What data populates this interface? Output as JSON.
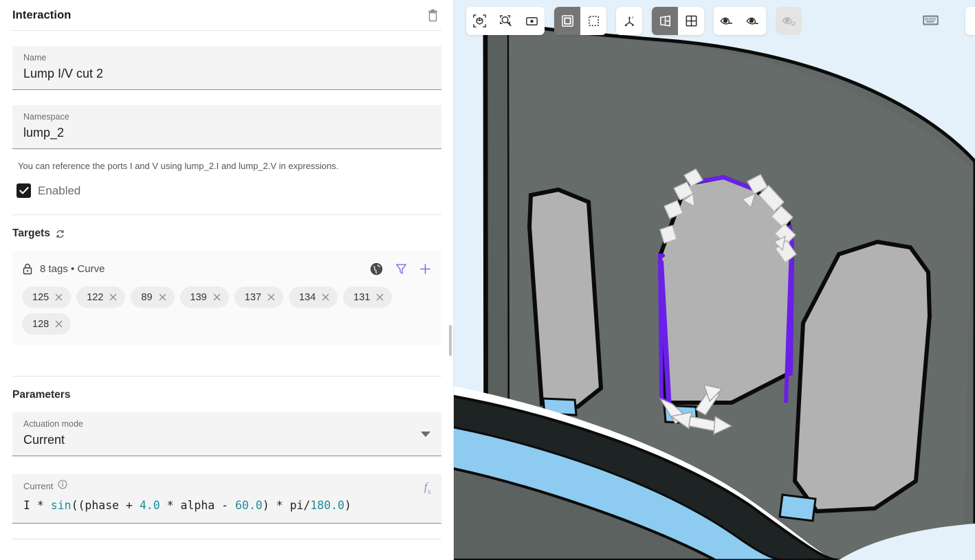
{
  "panel": {
    "title": "Interaction",
    "delete_icon": "trash-icon",
    "name_field": {
      "label": "Name",
      "value": "Lump I/V cut 2"
    },
    "namespace_field": {
      "label": "Namespace",
      "value": "lump_2"
    },
    "helper_text": "You can reference the ports I and V using lump_2.I and lump_2.V in expressions.",
    "enabled_checkbox": {
      "label": "Enabled",
      "checked": true
    },
    "targets": {
      "section_title": "Targets",
      "refresh_icon": "refresh-icon",
      "lock_icon": "lock-icon",
      "summary": "8 tags • Curve",
      "globe_icon": "globe-icon",
      "filter_icon": "filter-icon",
      "add_icon": "plus-icon",
      "chips": [
        "125",
        "122",
        "89",
        "139",
        "137",
        "134",
        "131",
        "128"
      ],
      "chip_remove_icon": "close-icon"
    },
    "parameters": {
      "section_title": "Parameters",
      "actuation_mode": {
        "label": "Actuation mode",
        "value": "Current",
        "dropdown_icon": "chevron-down-icon"
      },
      "current": {
        "label": "Current",
        "info_icon": "info-icon",
        "fx_icon": "fx-icon",
        "expression_tokens": [
          {
            "t": "I * ",
            "c": "plain"
          },
          {
            "t": "sin",
            "c": "fn"
          },
          {
            "t": "((phase + ",
            "c": "plain"
          },
          {
            "t": "4.0",
            "c": "num"
          },
          {
            "t": " * alpha - ",
            "c": "plain"
          },
          {
            "t": "60.0",
            "c": "num"
          },
          {
            "t": ") * pi/",
            "c": "plain"
          },
          {
            "t": "180.0",
            "c": "num"
          },
          {
            "t": ")",
            "c": "plain"
          }
        ],
        "expression_plain": "I * sin((phase + 4.0 * alpha - 60.0) * pi/180.0)"
      }
    }
  },
  "viewport": {
    "toolbar": {
      "groups": [
        {
          "buttons": [
            {
              "name": "fit-to-selection-icon",
              "active": false
            },
            {
              "name": "zoom-to-fit-icon",
              "active": false
            },
            {
              "name": "zoom-to-window-icon",
              "active": false
            }
          ]
        },
        {
          "buttons": [
            {
              "name": "rectangle-select-icon",
              "active": true
            },
            {
              "name": "marquee-select-icon",
              "active": false
            }
          ]
        },
        {
          "buttons": [
            {
              "name": "axis-orientation-icon",
              "active": false
            }
          ]
        },
        {
          "buttons": [
            {
              "name": "split-view-icon",
              "active": true
            },
            {
              "name": "grid-view-icon",
              "active": false
            }
          ]
        },
        {
          "buttons": [
            {
              "name": "show-hidden-icon",
              "active": false
            },
            {
              "name": "hide-selected-icon",
              "active": false
            }
          ]
        },
        {
          "buttons": [
            {
              "name": "reset-visibility-icon",
              "active": false,
              "disabled": true
            }
          ]
        }
      ],
      "keyboard_shortcuts_icon": "keyboard-icon"
    },
    "colors": {
      "background": "#e5f1fa",
      "body_dark": "#5a605e",
      "body_mid": "#6d7370",
      "magnet_gray": "#b0b0b0",
      "rotor_dark": "#3b3f3e",
      "coil_blue": "#8ecbf0",
      "selection_purple": "#6a20e8",
      "outline": "#0a0a0a"
    },
    "selection": {
      "highlight_color": "#6a20e8",
      "arrow_color": "#f0f0f0",
      "description": "selected magnet outline with direction arrows"
    }
  }
}
